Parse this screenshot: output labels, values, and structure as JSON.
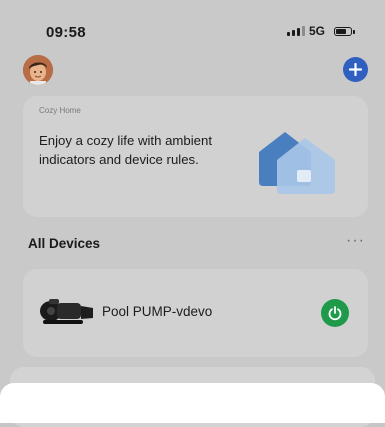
{
  "status_bar": {
    "time": "09:58",
    "network": "5G",
    "signal_bars": 3,
    "battery_level": 0.6
  },
  "header": {
    "avatar_icon": "user-avatar",
    "add_icon": "plus-icon",
    "accent_color": "#2f5fbf"
  },
  "cozy_card": {
    "label": "Cozy Home",
    "text": "Enjoy a cozy life with ambient indicators and device rules.",
    "icon": "house-icon"
  },
  "devices_section": {
    "title": "All Devices",
    "more_label": "···"
  },
  "devices": [
    {
      "name": "Pool PUMP-vdevo",
      "icon": "pool-pump-image",
      "power_icon": "power-icon",
      "power_on": true,
      "status_color": "#1e9a4a"
    }
  ]
}
